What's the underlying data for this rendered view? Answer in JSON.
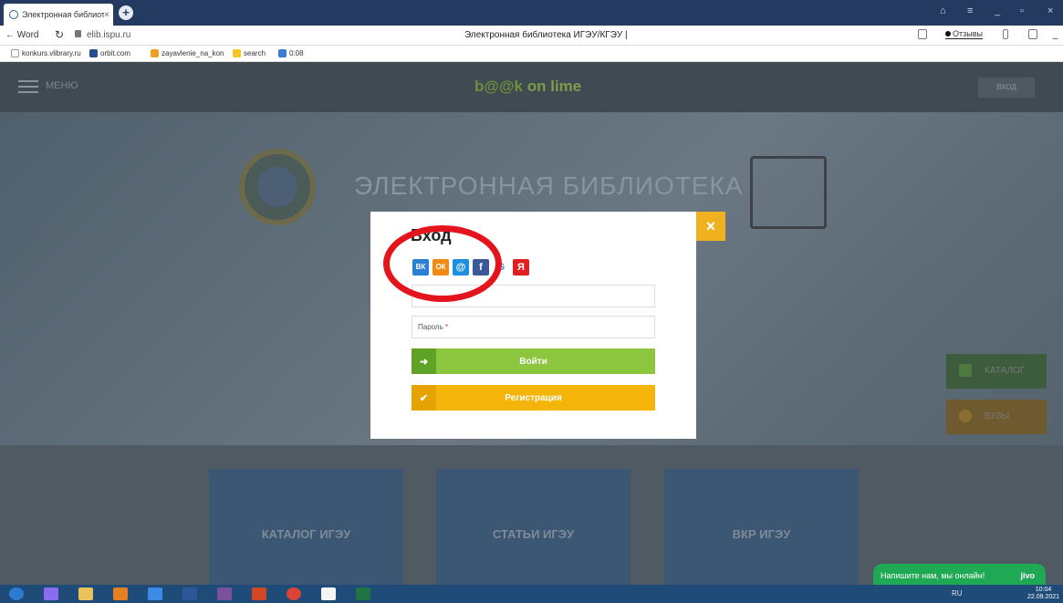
{
  "browser": {
    "tab_title": "Электронная библиоте",
    "tab_close": "×",
    "new_tab": "+",
    "back_label": "← Word",
    "reload": "↻",
    "url": "elib.ispu.ru",
    "page_title": "Электронная библиотека ИГЭУ/КГЭУ |",
    "feedback_label": "Отзывы",
    "window_controls": [
      "≡",
      "_",
      "▫",
      "×"
    ]
  },
  "bookmarks": [
    {
      "label": "konkurs.vlibrary.ru",
      "color": "#ffffff"
    },
    {
      "label": "orbit.com",
      "color": "#2a4c8c"
    },
    {
      "label": "zayavlenie_na_kon",
      "color": "#f0a020"
    },
    {
      "label": "search",
      "color": "#f3c623"
    },
    {
      "label": "0:08",
      "color": "#3a7bd5"
    }
  ],
  "site": {
    "menu_label": "МЕНЮ",
    "logo_b": "b",
    "logo_oo": "@@",
    "logo_k": "k",
    "logo_rest": " on lime",
    "login_label": "ВХОД",
    "hero_title": "ЭЛЕКТРОННАЯ БИБЛИОТЕКА",
    "side_buttons": [
      {
        "label": "КАТАЛОГ",
        "bg": "#3d5c3e",
        "icon": "#4f7a3f"
      },
      {
        "label": "ВУЗЫ",
        "bg": "#6e5a2e",
        "icon": "#8a6f30"
      }
    ],
    "cards": [
      "КАТАЛОГ ИГЭУ",
      "СТАТЬИ ИГЭУ",
      "ВКР ИГЭУ"
    ]
  },
  "modal": {
    "title": "Вход",
    "close": "×",
    "socials": [
      {
        "name": "vk",
        "glyph": "ВК",
        "color": "#2a7fd5"
      },
      {
        "name": "odnoklassniki",
        "glyph": "ОК",
        "color": "#f18a12"
      },
      {
        "name": "mailru",
        "glyph": "@",
        "color": "#1f8fe0"
      },
      {
        "name": "facebook",
        "glyph": "f",
        "color": "#3b5998"
      },
      {
        "name": "google",
        "glyph": "G",
        "color": "#4a86e8"
      },
      {
        "name": "yandex",
        "glyph": "Я",
        "color": "#e02020"
      }
    ],
    "login_value": "",
    "password_label": "Пароль",
    "required_mark": "*",
    "login_button": "Войти",
    "login_icon": "➜",
    "register_button": "Регистрация",
    "register_icon": "✔"
  },
  "chat": {
    "text": "Напишите нам, мы онлайн!",
    "brand": "jivo"
  },
  "taskbar": {
    "lang": "RU",
    "time": "10:04",
    "date": "22.09.2021"
  }
}
